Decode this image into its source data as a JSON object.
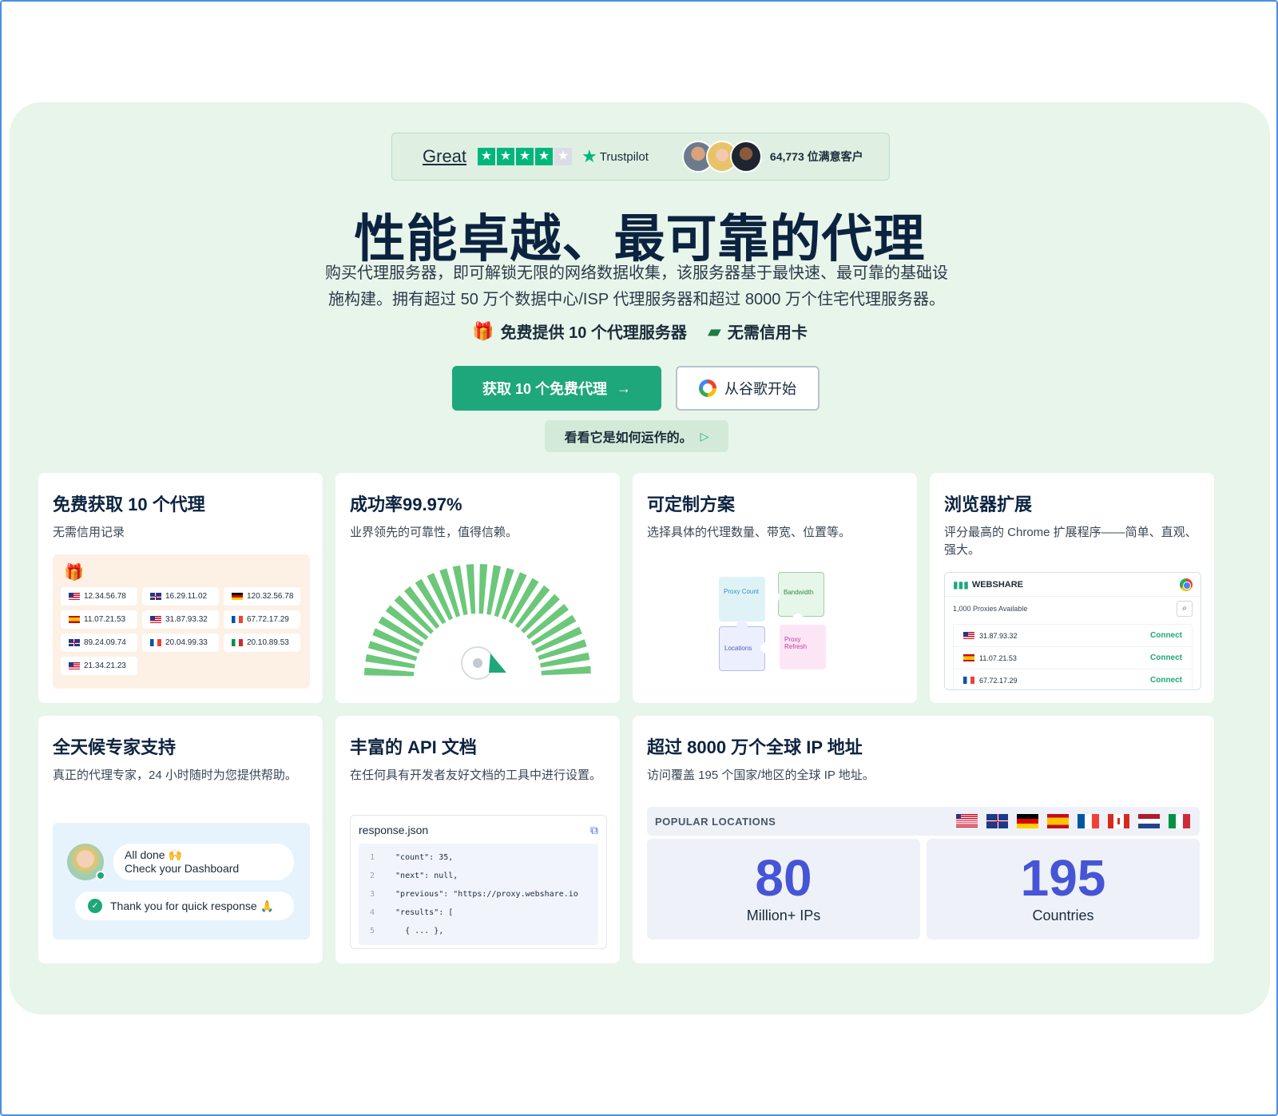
{
  "trustbar": {
    "rating_word": "Great",
    "provider": "Trustpilot",
    "customers": "64,773 位满意客户",
    "stars_filled": 4,
    "stars_total": 5
  },
  "hero": {
    "headline": "性能卓越、最可靠的代理",
    "subtitle_line1": "购买代理服务器，即可解锁无限的网络数据收集，该服务器基于最快速、最可靠的基础设",
    "subtitle_line2": "施构建。拥有超过 50 万个数据中心/ISP 代理服务器和超过 8000 万个住宅代理服务器。",
    "perk1": "免费提供 10 个代理服务器",
    "perk2": "无需信用卡",
    "cta_primary": "获取 10 个免费代理",
    "cta_google": "从谷歌开始",
    "watch": "看看它是如何运作的。"
  },
  "cards": {
    "free": {
      "title": "免费获取 10 个代理",
      "desc": "无需信用记录",
      "ips": [
        {
          "flag": "us",
          "ip": "12.34.56.78"
        },
        {
          "flag": "gb",
          "ip": "16.29.11.02"
        },
        {
          "flag": "de",
          "ip": "120.32.56.78"
        },
        {
          "flag": "es",
          "ip": "11.07.21.53"
        },
        {
          "flag": "us",
          "ip": "31.87.93.32"
        },
        {
          "flag": "fr",
          "ip": "67.72.17.29"
        },
        {
          "flag": "gb",
          "ip": "89.24.09.74"
        },
        {
          "flag": "fr",
          "ip": "20.04.99.33"
        },
        {
          "flag": "it",
          "ip": "20.10.89.53"
        },
        {
          "flag": "us",
          "ip": "21.34.21.23"
        }
      ]
    },
    "success": {
      "title": "成功率99.97%",
      "desc": "业界领先的可靠性，值得信赖。",
      "gauge_segments": 26,
      "gauge_color": "#6cc77a"
    },
    "custom": {
      "title": "可定制方案",
      "desc": "选择具体的代理数量、带宽、位置等。",
      "pieces": [
        "Proxy Count",
        "Bandwidth",
        "Locations",
        "Proxy Refresh"
      ]
    },
    "extension": {
      "title": "浏览器扩展",
      "desc": "评分最高的 Chrome 扩展程序——简单、直观、强大。",
      "brand": "WEBSHARE",
      "available": "1,000 Proxies Available",
      "connect": "Connect",
      "rows": [
        {
          "flag": "us",
          "ip": "31.87.93.32"
        },
        {
          "flag": "es",
          "ip": "11.07.21.53"
        },
        {
          "flag": "fr",
          "ip": "67.72.17.29"
        }
      ]
    },
    "support": {
      "title": "全天候专家支持",
      "desc": "真正的代理专家，24 小时随时为您提供帮助。",
      "msg1_line1": "All done 🙌",
      "msg1_line2": "Check your Dashboard",
      "msg2": "Thank you for quick response 🙏"
    },
    "api": {
      "title": "丰富的 API 文档",
      "desc": "在任何具有开发者友好文档的工具中进行设置。",
      "filename": "response.json",
      "lines": [
        {
          "n": "1",
          "code": "  \"count\": 35,"
        },
        {
          "n": "2",
          "code": "  \"next\": null,"
        },
        {
          "n": "3",
          "code": "  \"previous\": \"https://proxy.webshare.io"
        },
        {
          "n": "4",
          "code": "  \"results\": ["
        },
        {
          "n": "5",
          "code": "    { ... },"
        }
      ]
    },
    "global": {
      "title": "超过 8000 万个全球 IP 地址",
      "desc": "访问覆盖 195 个国家/地区的全球 IP 地址。",
      "popular": "POPULAR LOCATIONS",
      "flags": [
        "us",
        "gb",
        "de",
        "es",
        "fr",
        "ca",
        "nl",
        "it"
      ],
      "stat1_num": "80",
      "stat1_cap": "Million+ IPs",
      "stat2_num": "195",
      "stat2_cap": "Countries"
    }
  },
  "colors": {
    "hero_bg": "#e8f5ea",
    "brand_green": "#1ea77b",
    "stat_blue": "#4654d6"
  }
}
